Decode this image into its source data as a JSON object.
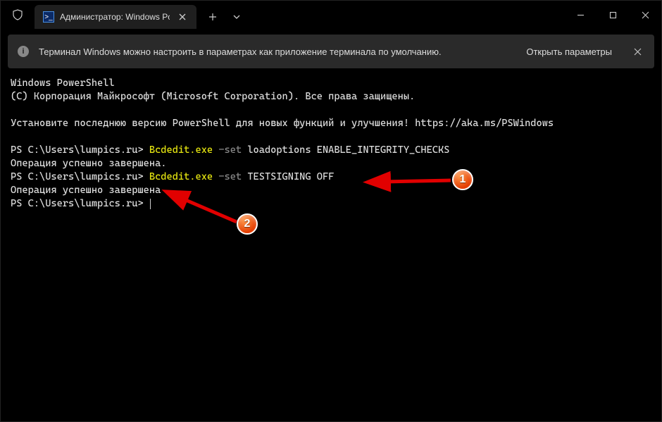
{
  "titlebar": {
    "tab_title": "Администратор: Windows Po"
  },
  "infobar": {
    "message": "Терминал Windows можно настроить в параметрах как приложение терминала по умолчанию.",
    "action_label": "Открыть параметры"
  },
  "terminal": {
    "header1": "Windows PowerShell",
    "header2": "(C) Корпорация Майкрософт (Microsoft Corporation). Все права защищены.",
    "install_msg": "Установите последнюю версию PowerShell для новых функций и улучшения! https://aka.ms/PSWindows",
    "prompt": "PS C:\\Users\\lumpics.ru>",
    "cmd1_exe": "Bcdedit.exe",
    "cmd1_flag": "-set",
    "cmd1_args": "loadoptions ENABLE_INTEGRITY_CHECKS",
    "result1": "Операция успешно завершена.",
    "cmd2_exe": "Bcdedit.exe",
    "cmd2_flag": "-set",
    "cmd2_args": "TESTSIGNING OFF",
    "result2": "Операция успешно завершена"
  },
  "annotations": {
    "badge1": "1",
    "badge2": "2"
  }
}
